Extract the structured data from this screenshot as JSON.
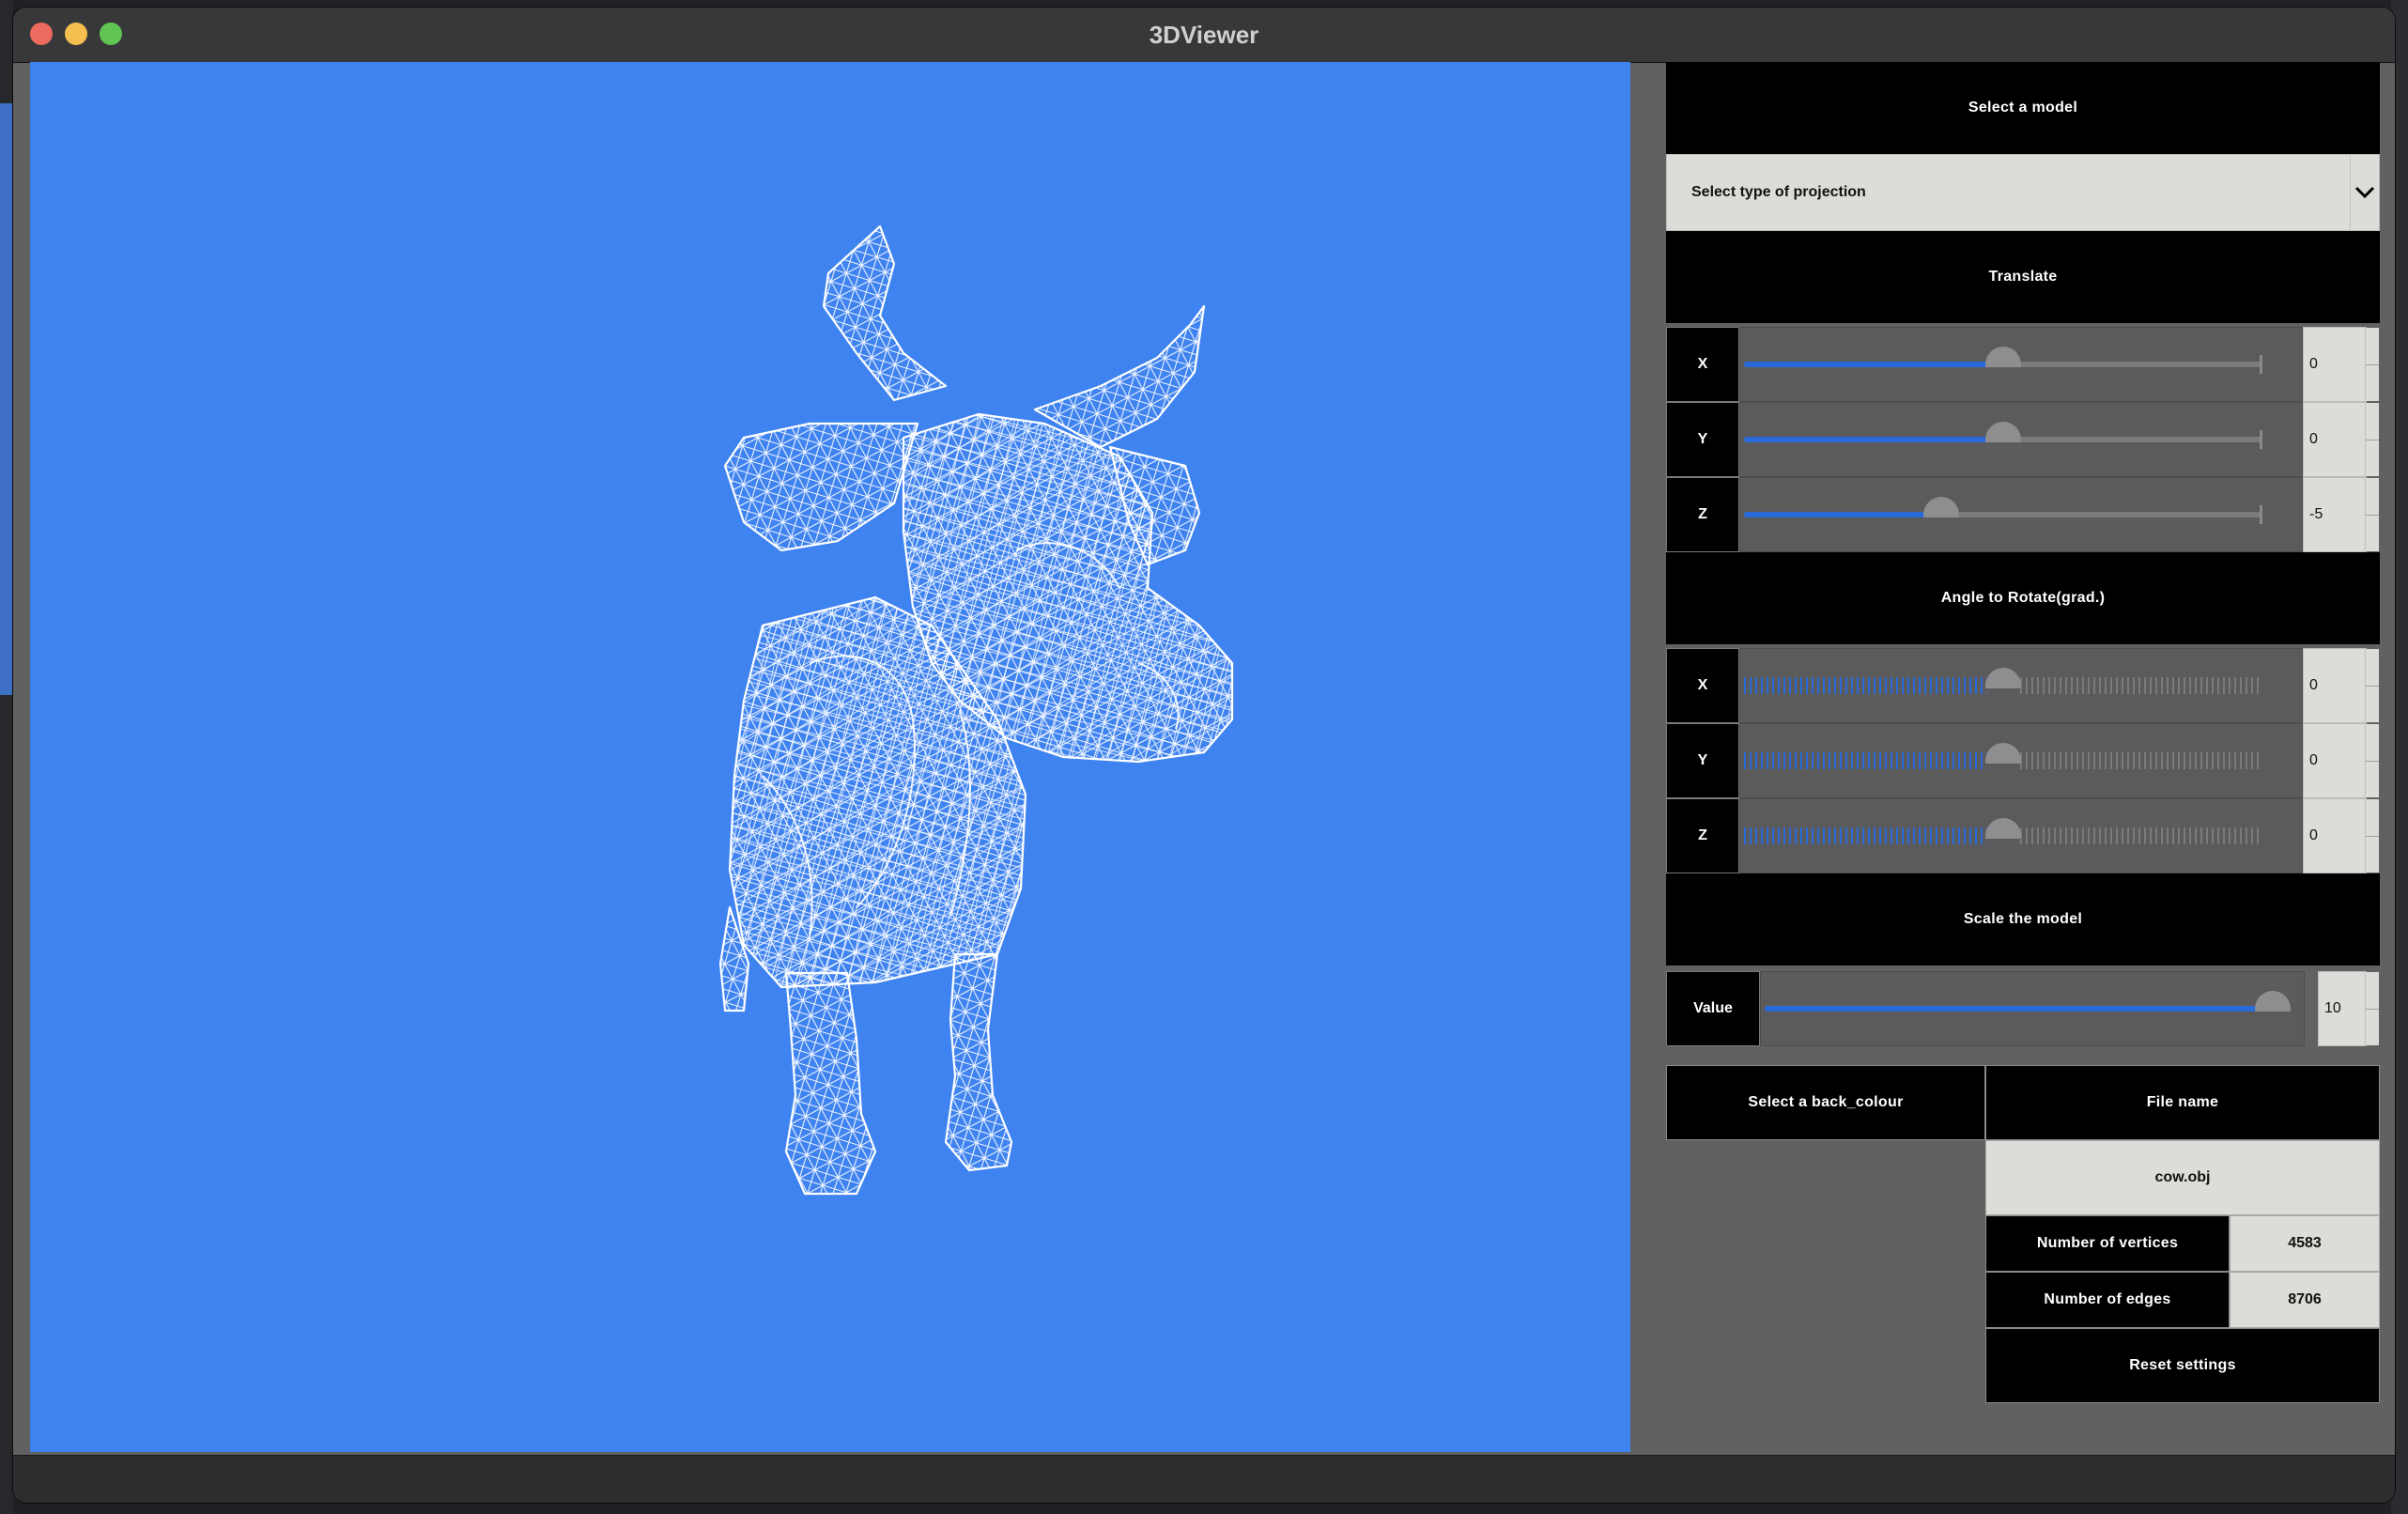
{
  "window": {
    "title": "3DViewer"
  },
  "panel": {
    "select_model": "Select a model",
    "projection": {
      "placeholder": "Select type of projection"
    },
    "translate": {
      "title": "Translate",
      "rows": [
        {
          "axis": "X",
          "value": "0",
          "position": 0.5
        },
        {
          "axis": "Y",
          "value": "0",
          "position": 0.5
        },
        {
          "axis": "Z",
          "value": "-5",
          "position": 0.38
        }
      ]
    },
    "rotate": {
      "title": "Angle to Rotate(grad.)",
      "rows": [
        {
          "axis": "X",
          "value": "0",
          "position": 0.5
        },
        {
          "axis": "Y",
          "value": "0",
          "position": 0.5
        },
        {
          "axis": "Z",
          "value": "0",
          "position": 0.5
        }
      ]
    },
    "scale": {
      "title": "Scale the model",
      "label": "Value",
      "value": "10",
      "position": 0.98
    },
    "back_colour": "Select a back_colour",
    "file": {
      "header": "File name",
      "name": "cow.obj",
      "vertices_label": "Number of vertices",
      "vertices": "4583",
      "edges_label": "Number of edges",
      "edges": "8706"
    },
    "reset": "Reset settings"
  },
  "colors": {
    "viewport_background": "#3f83f0",
    "panel_background": "#616161",
    "slider_fill": "#2a6ad8",
    "wireframe": "#ffffff"
  }
}
